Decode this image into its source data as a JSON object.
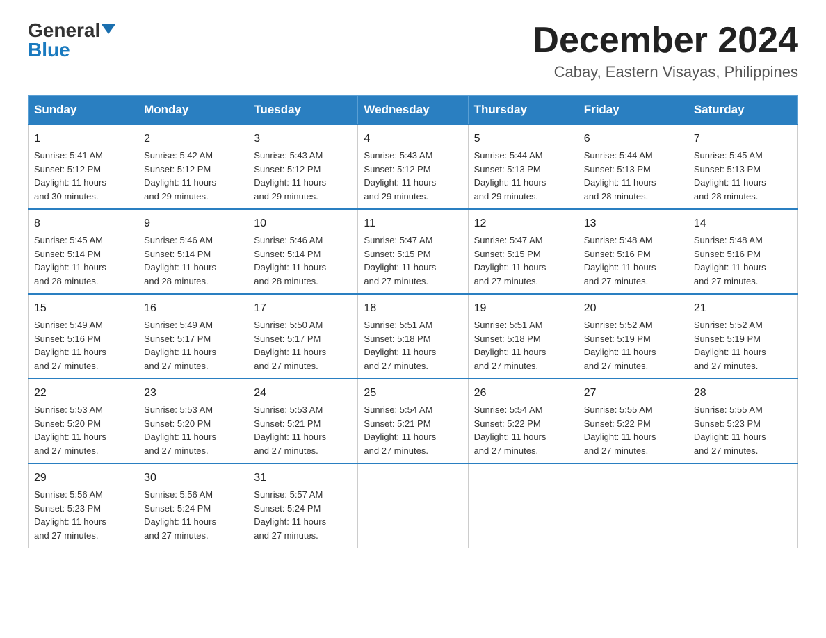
{
  "header": {
    "logo_top": "General",
    "logo_bottom": "Blue",
    "month_title": "December 2024",
    "location": "Cabay, Eastern Visayas, Philippines"
  },
  "days_of_week": [
    "Sunday",
    "Monday",
    "Tuesday",
    "Wednesday",
    "Thursday",
    "Friday",
    "Saturday"
  ],
  "weeks": [
    [
      {
        "day": "1",
        "sunrise": "5:41 AM",
        "sunset": "5:12 PM",
        "daylight": "11 hours and 30 minutes."
      },
      {
        "day": "2",
        "sunrise": "5:42 AM",
        "sunset": "5:12 PM",
        "daylight": "11 hours and 29 minutes."
      },
      {
        "day": "3",
        "sunrise": "5:43 AM",
        "sunset": "5:12 PM",
        "daylight": "11 hours and 29 minutes."
      },
      {
        "day": "4",
        "sunrise": "5:43 AM",
        "sunset": "5:12 PM",
        "daylight": "11 hours and 29 minutes."
      },
      {
        "day": "5",
        "sunrise": "5:44 AM",
        "sunset": "5:13 PM",
        "daylight": "11 hours and 29 minutes."
      },
      {
        "day": "6",
        "sunrise": "5:44 AM",
        "sunset": "5:13 PM",
        "daylight": "11 hours and 28 minutes."
      },
      {
        "day": "7",
        "sunrise": "5:45 AM",
        "sunset": "5:13 PM",
        "daylight": "11 hours and 28 minutes."
      }
    ],
    [
      {
        "day": "8",
        "sunrise": "5:45 AM",
        "sunset": "5:14 PM",
        "daylight": "11 hours and 28 minutes."
      },
      {
        "day": "9",
        "sunrise": "5:46 AM",
        "sunset": "5:14 PM",
        "daylight": "11 hours and 28 minutes."
      },
      {
        "day": "10",
        "sunrise": "5:46 AM",
        "sunset": "5:14 PM",
        "daylight": "11 hours and 28 minutes."
      },
      {
        "day": "11",
        "sunrise": "5:47 AM",
        "sunset": "5:15 PM",
        "daylight": "11 hours and 27 minutes."
      },
      {
        "day": "12",
        "sunrise": "5:47 AM",
        "sunset": "5:15 PM",
        "daylight": "11 hours and 27 minutes."
      },
      {
        "day": "13",
        "sunrise": "5:48 AM",
        "sunset": "5:16 PM",
        "daylight": "11 hours and 27 minutes."
      },
      {
        "day": "14",
        "sunrise": "5:48 AM",
        "sunset": "5:16 PM",
        "daylight": "11 hours and 27 minutes."
      }
    ],
    [
      {
        "day": "15",
        "sunrise": "5:49 AM",
        "sunset": "5:16 PM",
        "daylight": "11 hours and 27 minutes."
      },
      {
        "day": "16",
        "sunrise": "5:49 AM",
        "sunset": "5:17 PM",
        "daylight": "11 hours and 27 minutes."
      },
      {
        "day": "17",
        "sunrise": "5:50 AM",
        "sunset": "5:17 PM",
        "daylight": "11 hours and 27 minutes."
      },
      {
        "day": "18",
        "sunrise": "5:51 AM",
        "sunset": "5:18 PM",
        "daylight": "11 hours and 27 minutes."
      },
      {
        "day": "19",
        "sunrise": "5:51 AM",
        "sunset": "5:18 PM",
        "daylight": "11 hours and 27 minutes."
      },
      {
        "day": "20",
        "sunrise": "5:52 AM",
        "sunset": "5:19 PM",
        "daylight": "11 hours and 27 minutes."
      },
      {
        "day": "21",
        "sunrise": "5:52 AM",
        "sunset": "5:19 PM",
        "daylight": "11 hours and 27 minutes."
      }
    ],
    [
      {
        "day": "22",
        "sunrise": "5:53 AM",
        "sunset": "5:20 PM",
        "daylight": "11 hours and 27 minutes."
      },
      {
        "day": "23",
        "sunrise": "5:53 AM",
        "sunset": "5:20 PM",
        "daylight": "11 hours and 27 minutes."
      },
      {
        "day": "24",
        "sunrise": "5:53 AM",
        "sunset": "5:21 PM",
        "daylight": "11 hours and 27 minutes."
      },
      {
        "day": "25",
        "sunrise": "5:54 AM",
        "sunset": "5:21 PM",
        "daylight": "11 hours and 27 minutes."
      },
      {
        "day": "26",
        "sunrise": "5:54 AM",
        "sunset": "5:22 PM",
        "daylight": "11 hours and 27 minutes."
      },
      {
        "day": "27",
        "sunrise": "5:55 AM",
        "sunset": "5:22 PM",
        "daylight": "11 hours and 27 minutes."
      },
      {
        "day": "28",
        "sunrise": "5:55 AM",
        "sunset": "5:23 PM",
        "daylight": "11 hours and 27 minutes."
      }
    ],
    [
      {
        "day": "29",
        "sunrise": "5:56 AM",
        "sunset": "5:23 PM",
        "daylight": "11 hours and 27 minutes."
      },
      {
        "day": "30",
        "sunrise": "5:56 AM",
        "sunset": "5:24 PM",
        "daylight": "11 hours and 27 minutes."
      },
      {
        "day": "31",
        "sunrise": "5:57 AM",
        "sunset": "5:24 PM",
        "daylight": "11 hours and 27 minutes."
      },
      null,
      null,
      null,
      null
    ]
  ],
  "labels": {
    "sunrise": "Sunrise:",
    "sunset": "Sunset:",
    "daylight": "Daylight:"
  }
}
